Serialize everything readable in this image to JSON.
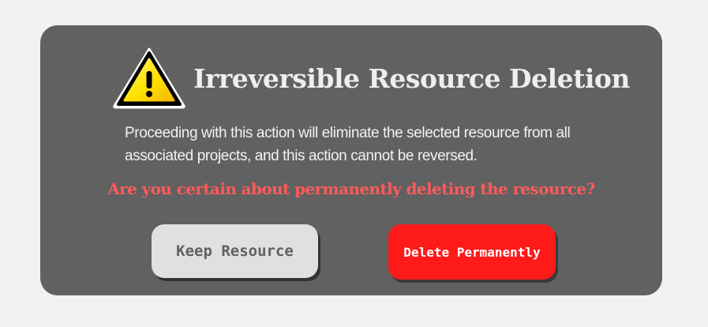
{
  "dialog": {
    "icon": "warning-icon",
    "title": "Irreversible Resource Deletion",
    "message_line_1": "Proceeding with this action will eliminate the selected resource from all",
    "message_line_2": "associated projects, and this action cannot be reversed.",
    "question": "Are you certain about permanently deleting the resource?",
    "keep_button_label": "Keep Resource",
    "delete_button_label": "Delete Permanently"
  },
  "colors": {
    "page_background": "#f2f2f2",
    "dialog_background": "#616161",
    "question_text": "#ff5a5a",
    "keep_button": "#e0e0e0",
    "delete_button": "#ff1a1a",
    "warning_yellow": "#ffd800"
  }
}
